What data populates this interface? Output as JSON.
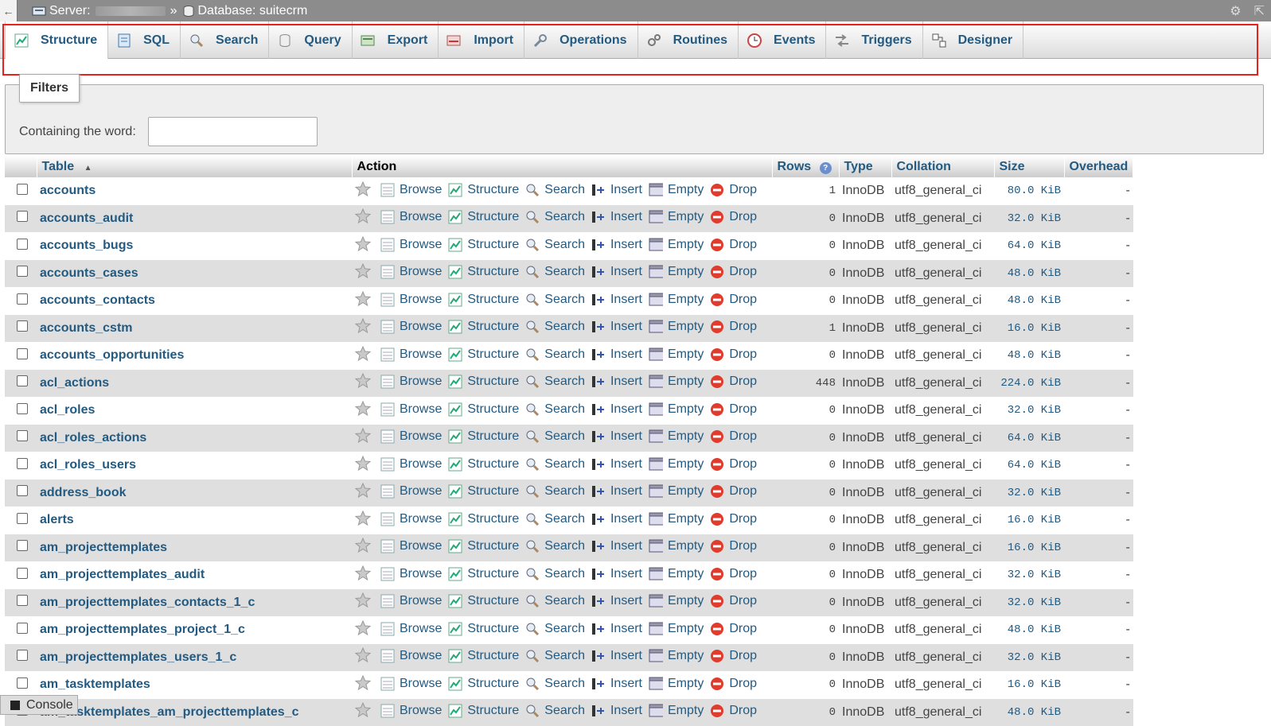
{
  "topbar": {
    "server_label": "Server:",
    "sep": "»",
    "database_label": "Database: suitecrm"
  },
  "tabs": [
    {
      "label": "Structure",
      "icon": "structure-icon"
    },
    {
      "label": "SQL",
      "icon": "sql-icon"
    },
    {
      "label": "Search",
      "icon": "search-icon"
    },
    {
      "label": "Query",
      "icon": "query-icon"
    },
    {
      "label": "Export",
      "icon": "export-icon"
    },
    {
      "label": "Import",
      "icon": "import-icon"
    },
    {
      "label": "Operations",
      "icon": "wrench-icon"
    },
    {
      "label": "Routines",
      "icon": "routines-icon"
    },
    {
      "label": "Events",
      "icon": "clock-icon"
    },
    {
      "label": "Triggers",
      "icon": "triggers-icon"
    },
    {
      "label": "Designer",
      "icon": "designer-icon"
    }
  ],
  "filters": {
    "legend": "Filters",
    "label": "Containing the word:",
    "value": ""
  },
  "table": {
    "headers": {
      "table": "Table",
      "action": "Action",
      "rows": "Rows",
      "type": "Type",
      "collation": "Collation",
      "size": "Size",
      "overhead": "Overhead"
    },
    "actions": {
      "browse": "Browse",
      "structure": "Structure",
      "search": "Search",
      "insert": "Insert",
      "empty": "Empty",
      "drop": "Drop"
    },
    "rows": [
      {
        "name": "accounts",
        "rows": "1",
        "type": "InnoDB",
        "collation": "utf8_general_ci",
        "size": "80.0 KiB",
        "overhead": "-"
      },
      {
        "name": "accounts_audit",
        "rows": "0",
        "type": "InnoDB",
        "collation": "utf8_general_ci",
        "size": "32.0 KiB",
        "overhead": "-"
      },
      {
        "name": "accounts_bugs",
        "rows": "0",
        "type": "InnoDB",
        "collation": "utf8_general_ci",
        "size": "64.0 KiB",
        "overhead": "-"
      },
      {
        "name": "accounts_cases",
        "rows": "0",
        "type": "InnoDB",
        "collation": "utf8_general_ci",
        "size": "48.0 KiB",
        "overhead": "-"
      },
      {
        "name": "accounts_contacts",
        "rows": "0",
        "type": "InnoDB",
        "collation": "utf8_general_ci",
        "size": "48.0 KiB",
        "overhead": "-"
      },
      {
        "name": "accounts_cstm",
        "rows": "1",
        "type": "InnoDB",
        "collation": "utf8_general_ci",
        "size": "16.0 KiB",
        "overhead": "-"
      },
      {
        "name": "accounts_opportunities",
        "rows": "0",
        "type": "InnoDB",
        "collation": "utf8_general_ci",
        "size": "48.0 KiB",
        "overhead": "-"
      },
      {
        "name": "acl_actions",
        "rows": "448",
        "type": "InnoDB",
        "collation": "utf8_general_ci",
        "size": "224.0 KiB",
        "overhead": "-"
      },
      {
        "name": "acl_roles",
        "rows": "0",
        "type": "InnoDB",
        "collation": "utf8_general_ci",
        "size": "32.0 KiB",
        "overhead": "-"
      },
      {
        "name": "acl_roles_actions",
        "rows": "0",
        "type": "InnoDB",
        "collation": "utf8_general_ci",
        "size": "64.0 KiB",
        "overhead": "-"
      },
      {
        "name": "acl_roles_users",
        "rows": "0",
        "type": "InnoDB",
        "collation": "utf8_general_ci",
        "size": "64.0 KiB",
        "overhead": "-"
      },
      {
        "name": "address_book",
        "rows": "0",
        "type": "InnoDB",
        "collation": "utf8_general_ci",
        "size": "32.0 KiB",
        "overhead": "-"
      },
      {
        "name": "alerts",
        "rows": "0",
        "type": "InnoDB",
        "collation": "utf8_general_ci",
        "size": "16.0 KiB",
        "overhead": "-"
      },
      {
        "name": "am_projecttemplates",
        "rows": "0",
        "type": "InnoDB",
        "collation": "utf8_general_ci",
        "size": "16.0 KiB",
        "overhead": "-"
      },
      {
        "name": "am_projecttemplates_audit",
        "rows": "0",
        "type": "InnoDB",
        "collation": "utf8_general_ci",
        "size": "32.0 KiB",
        "overhead": "-"
      },
      {
        "name": "am_projecttemplates_contacts_1_c",
        "rows": "0",
        "type": "InnoDB",
        "collation": "utf8_general_ci",
        "size": "32.0 KiB",
        "overhead": "-"
      },
      {
        "name": "am_projecttemplates_project_1_c",
        "rows": "0",
        "type": "InnoDB",
        "collation": "utf8_general_ci",
        "size": "48.0 KiB",
        "overhead": "-"
      },
      {
        "name": "am_projecttemplates_users_1_c",
        "rows": "0",
        "type": "InnoDB",
        "collation": "utf8_general_ci",
        "size": "32.0 KiB",
        "overhead": "-"
      },
      {
        "name": "am_tasktemplates",
        "rows": "0",
        "type": "InnoDB",
        "collation": "utf8_general_ci",
        "size": "16.0 KiB",
        "overhead": "-"
      },
      {
        "name": "am_tasktemplates_am_projecttemplates_c",
        "rows": "0",
        "type": "InnoDB",
        "collation": "utf8_general_ci",
        "size": "48.0 KiB",
        "overhead": "-"
      }
    ]
  },
  "console": {
    "label": "Console"
  },
  "colors": {
    "link": "#235a81",
    "highlight": "#e8211a",
    "drop": "#e03b2c"
  }
}
